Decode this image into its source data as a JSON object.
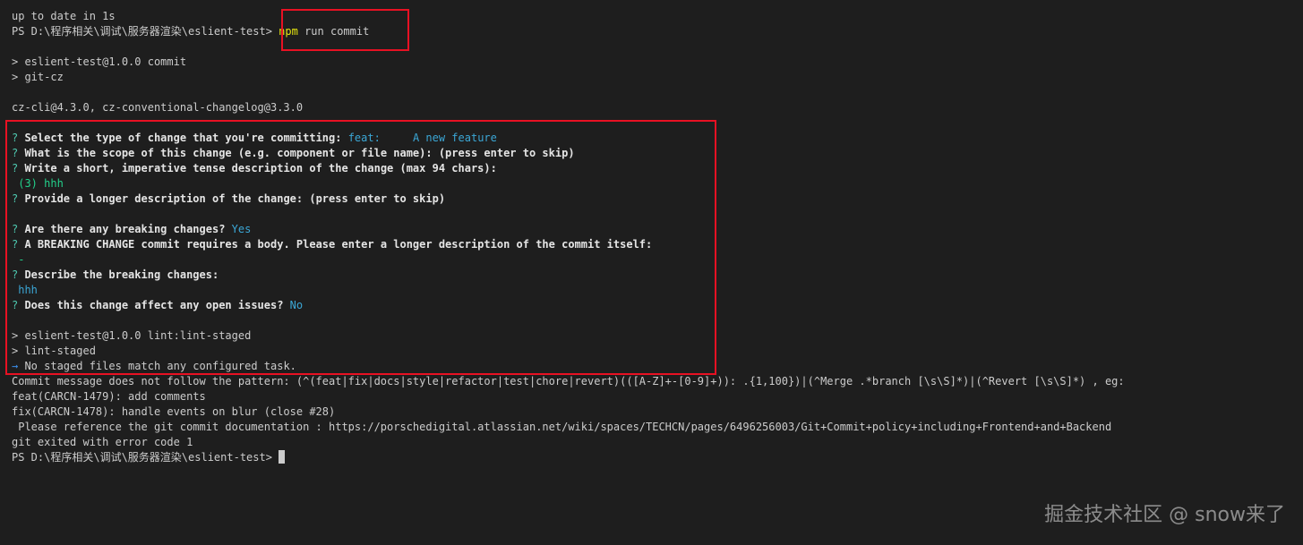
{
  "terminal": {
    "lines": {
      "l01": "up to date in 1s",
      "l02_prompt": "PS D:\\程序相关\\调试\\服务器渲染\\eslient-test> ",
      "l02_cmd": "npm",
      "l02_args": " run commit",
      "l04": "> eslient-test@1.0.0 commit",
      "l05": "> git-cz",
      "l07": "cz-cli@4.3.0, cz-conventional-changelog@3.3.0",
      "q_mark": "?",
      "l09_q": " Select the type of change that you're committing: ",
      "l09_a": "feat:     A new feature",
      "l10_q": " What is the scope of this change (e.g. component or file name): (press enter to skip)",
      "l11_q": " Write a short, imperative tense description of the change (max 94 chars):",
      "l12_a": " (3) hhh",
      "l13_q": " Provide a longer description of the change: (press enter to skip)",
      "l15_q": " Are there any breaking changes? ",
      "l15_a": "Yes",
      "l16_q": " A BREAKING CHANGE commit requires a body. Please enter a longer description of the commit itself:",
      "l17_a": " -",
      "l18_q": " Describe the breaking changes:",
      "l19_a": " hhh",
      "l20_q": " Does this change affect any open issues? ",
      "l20_a": "No",
      "l22": "> eslient-test@1.0.0 lint:lint-staged",
      "l23": "> lint-staged",
      "l24_arrow": "→",
      "l24": " No staged files match any configured task.",
      "l25": "Commit message does not follow the pattern: (^(feat|fix|docs|style|refactor|test|chore|revert)(([A-Z]+-[0-9]+)): .{1,100})|(^Merge .*branch [\\s\\S]*)|(^Revert [\\s\\S]*) , eg:",
      "l26": "feat(CARCN-1479): add comments",
      "l27": "fix(CARCN-1478): handle events on blur (close #28)",
      "l28": " Please reference the git commit documentation : https://porschedigital.atlassian.net/wiki/spaces/TECHCN/pages/6496256003/Git+Commit+policy+including+Frontend+and+Backend",
      "l29": "git exited with error code 1",
      "l30_prompt": "PS D:\\程序相关\\调试\\服务器渲染\\eslient-test> "
    }
  },
  "watermark": "掘金技术社区 @ snow来了",
  "colors": {
    "background": "#1e1e1e",
    "text": "#cccccc",
    "question_mark": "#4ec9b0",
    "answer": "#3ba7d6",
    "command": "#e5e510",
    "highlight_border": "#e81123"
  }
}
